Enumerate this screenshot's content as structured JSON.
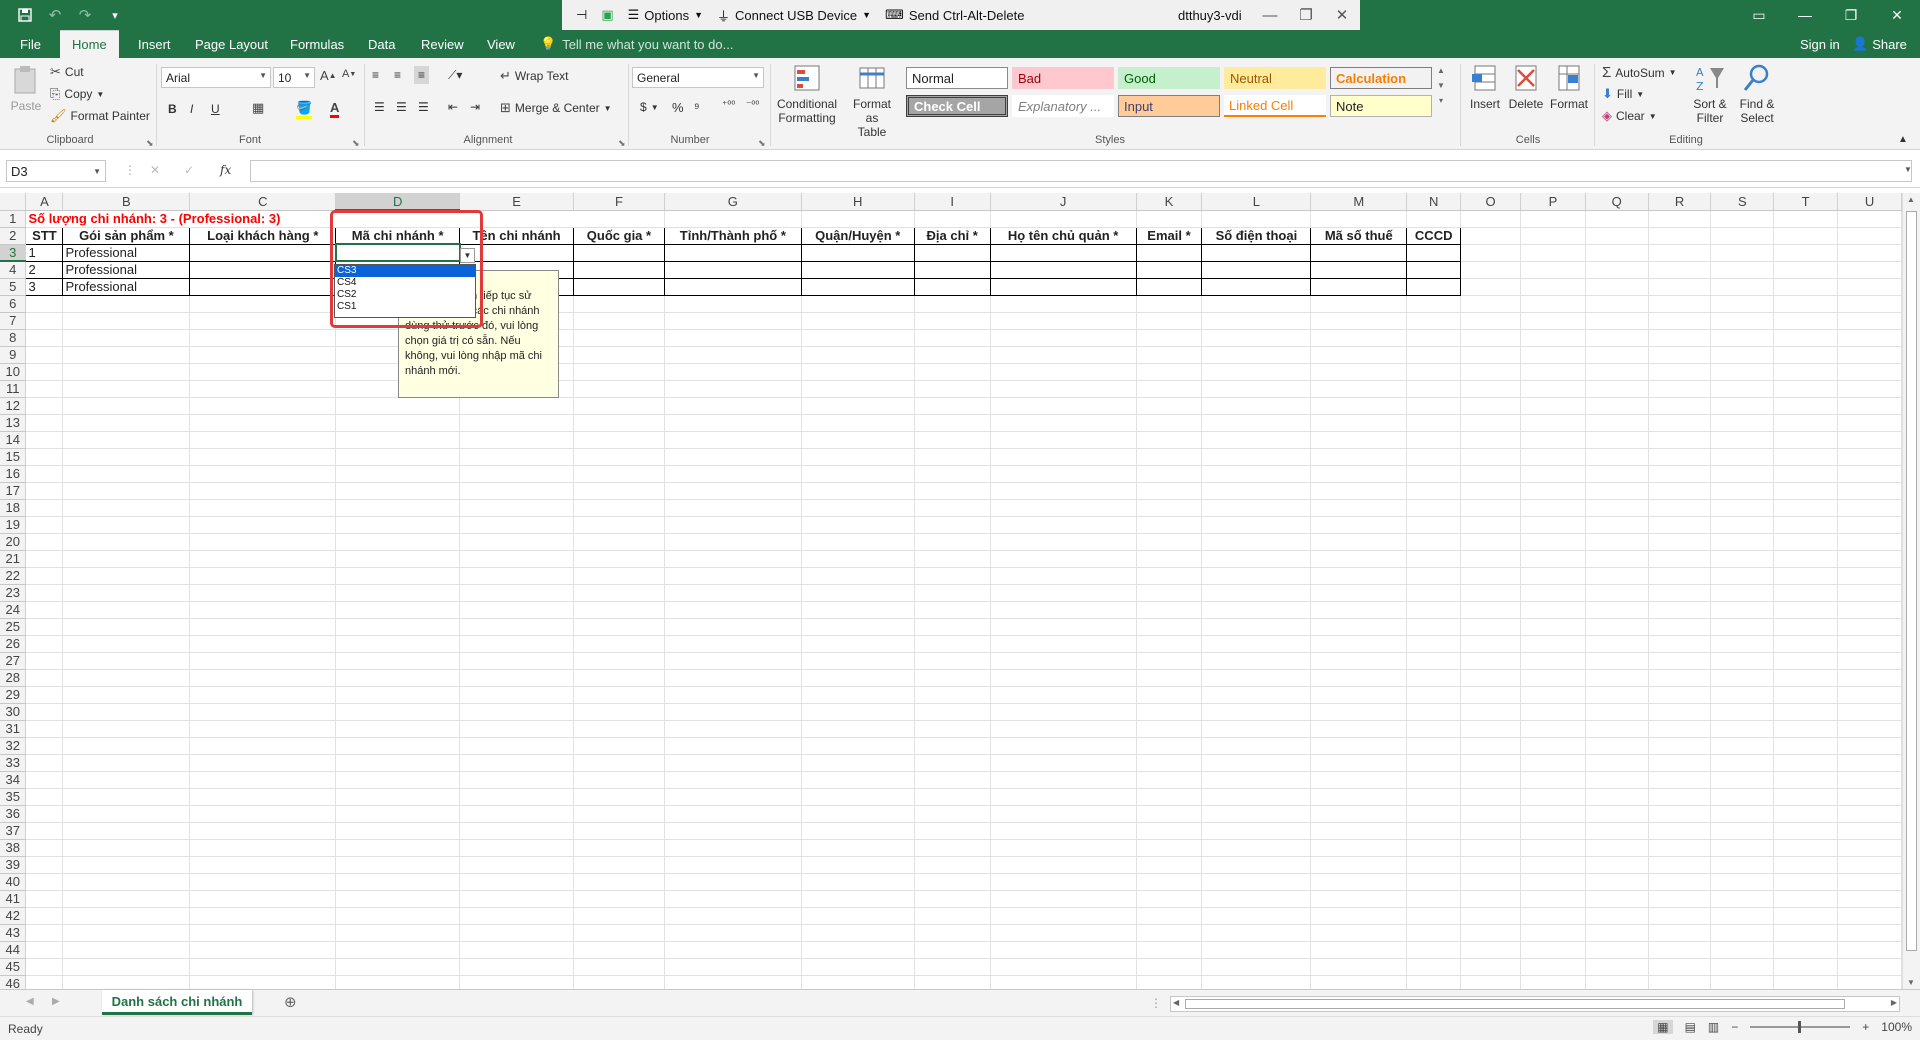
{
  "titlebar": {
    "quick_access": {
      "save": "💾",
      "undo": "↶",
      "redo": "↷",
      "customize": "▾"
    },
    "vdi": {
      "options": "Options",
      "connect_usb": "Connect USB Device",
      "send_cad": "Send Ctrl-Alt-Delete",
      "machine": "dtthuy3-vdi"
    }
  },
  "tabs": [
    "File",
    "Home",
    "Insert",
    "Page Layout",
    "Formulas",
    "Data",
    "Review",
    "View"
  ],
  "active_tab": "Home",
  "tell_me": "Tell me what you want to do...",
  "account": {
    "sign_in": "Sign in",
    "share": "Share"
  },
  "ribbon": {
    "clipboard": {
      "paste": "Paste",
      "cut": "Cut",
      "copy": "Copy",
      "format_painter": "Format Painter",
      "label": "Clipboard"
    },
    "font": {
      "name": "Arial",
      "size": "10",
      "label": "Font",
      "bold": "B",
      "italic": "I",
      "underline": "U"
    },
    "alignment": {
      "wrap_text": "Wrap Text",
      "merge_center": "Merge & Center",
      "label": "Alignment"
    },
    "number": {
      "format": "General",
      "currency": "$",
      "percent": "%",
      "label": "Number"
    },
    "styles": {
      "conditional": "Conditional Formatting",
      "format_table": "Format as Table",
      "items": [
        "Normal",
        "Bad",
        "Good",
        "Neutral",
        "Calculation",
        "Check Cell",
        "Explanatory ...",
        "Input",
        "Linked Cell",
        "Note"
      ],
      "label": "Styles"
    },
    "cells": {
      "insert": "Insert",
      "delete": "Delete",
      "format": "Format",
      "label": "Cells"
    },
    "editing": {
      "autosum": "AutoSum",
      "fill": "Fill",
      "clear": "Clear",
      "sort_filter": "Sort & Filter",
      "find_select": "Find & Select",
      "label": "Editing"
    }
  },
  "formula_bar": {
    "name_box": "D3",
    "fx": "fx",
    "value": ""
  },
  "columns": [
    "A",
    "B",
    "C",
    "D",
    "E",
    "F",
    "G",
    "H",
    "I",
    "J",
    "K",
    "L",
    "M",
    "N",
    "O",
    "P",
    "Q",
    "R",
    "S",
    "T",
    "U"
  ],
  "sheet": {
    "title": "Số lượng chi nhánh: 3 - (Professional: 3)",
    "headers": [
      "STT",
      "Gói sản phẩm *",
      "Loại khách hàng *",
      "Mã chi nhánh *",
      "Tên chi nhánh",
      "Quốc gia *",
      "Tỉnh/Thành phố *",
      "Quận/Huyện *",
      "Địa chỉ *",
      "Họ tên chủ quản *",
      "Email *",
      "Số điện thoại",
      "Mã số thuế",
      "CCCD"
    ],
    "rows": [
      [
        "1",
        "Professional"
      ],
      [
        "2",
        "Professional"
      ],
      [
        "3",
        "Professional"
      ]
    ],
    "row_count": 46
  },
  "dropdown": {
    "options": [
      "CS3",
      "CS4",
      "CS2",
      "CS1"
    ],
    "highlighted": "CS3"
  },
  "input_message": "Nếu bạn muốn tiếp tục sử dụng mã của các chi nhánh dùng thử trước đó, vui lòng chọn giá trị có sẵn. Nếu không, vui lòng nhập mã chi nhánh mới.",
  "sheet_tab": "Danh sách chi nhánh",
  "status": {
    "ready": "Ready",
    "zoom": "100%"
  }
}
